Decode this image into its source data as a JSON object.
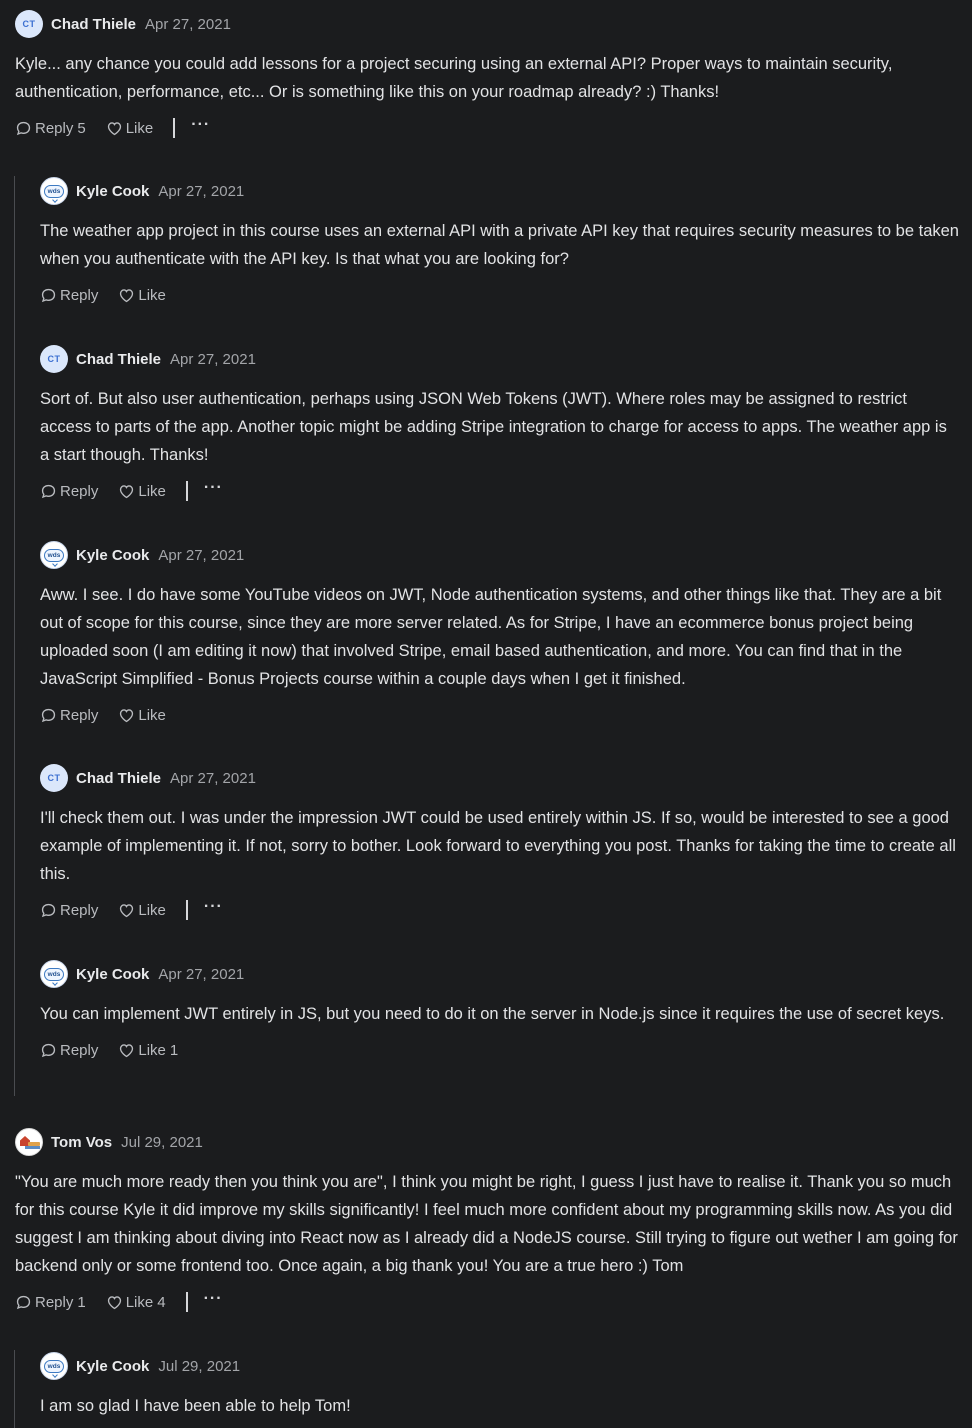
{
  "labels": {
    "reply": "Reply",
    "like": "Like",
    "more": "···"
  },
  "comments": [
    {
      "initials": "CT",
      "author": "Chad Thiele",
      "date": "Apr 27, 2021",
      "text": "Kyle... any chance you could add lessons for a project securing using an external API? Proper ways to maintain security, authentication, performance, etc... Or is something like this on your roadmap already? :) Thanks!",
      "reply_count": "5",
      "like_count": ""
    },
    {
      "initials": "wds",
      "author": "Kyle Cook",
      "date": "Apr 27, 2021",
      "text": "The weather app project in this course uses an external API with a private API key that requires security measures to be taken when you authenticate with the API key. Is that what you are looking for?",
      "reply_count": "",
      "like_count": ""
    },
    {
      "initials": "CT",
      "author": "Chad Thiele",
      "date": "Apr 27, 2021",
      "text": "Sort of. But also user authentication, perhaps using JSON Web Tokens (JWT). Where roles may be assigned to restrict access to parts of the app. Another topic might be adding Stripe integration to charge for access to apps. The weather app is a start though. Thanks!",
      "reply_count": "",
      "like_count": ""
    },
    {
      "initials": "wds",
      "author": "Kyle Cook",
      "date": "Apr 27, 2021",
      "text": "Aww. I see. I do have some YouTube videos on JWT, Node authentication systems, and other things like that. They are a bit out of scope for this course, since they are more server related. As for Stripe, I have an ecommerce bonus project being uploaded soon (I am editing it now) that involved Stripe, email based authentication, and more. You can find that in the JavaScript Simplified - Bonus Projects course within a couple days when I get it finished.",
      "reply_count": "",
      "like_count": ""
    },
    {
      "initials": "CT",
      "author": "Chad Thiele",
      "date": "Apr 27, 2021",
      "text": "I'll check them out. I was under the impression JWT could be used entirely within JS. If so, would be interested to see a good example of implementing it. If not, sorry to bother. Look forward to everything you post. Thanks for taking the time to create all this.",
      "reply_count": "",
      "like_count": ""
    },
    {
      "initials": "wds",
      "author": "Kyle Cook",
      "date": "Apr 27, 2021",
      "text": "You can implement JWT entirely in JS, but you need to do it on the server in Node.js since it requires the use of secret keys.",
      "reply_count": "",
      "like_count": "1"
    },
    {
      "initials": "",
      "author": "Tom Vos",
      "date": "Jul 29, 2021",
      "text": "\"You are much more ready then you think you are\", I think you might be right, I guess I just have to realise it. Thank you so much for this course Kyle it did improve my skills significantly! I feel much more confident about my programming skills now. As you did suggest I am thinking about diving into React now as I already did a NodeJS course. Still trying to figure out wether I am going for backend only or some frontend too. Once again, a big thank you! You are a true hero :) Tom",
      "reply_count": "1",
      "like_count": "4"
    },
    {
      "initials": "wds",
      "author": "Kyle Cook",
      "date": "Jul 29, 2021",
      "text": "I am so glad I have been able to help Tom!",
      "reply_count": "",
      "like_count": ""
    }
  ]
}
